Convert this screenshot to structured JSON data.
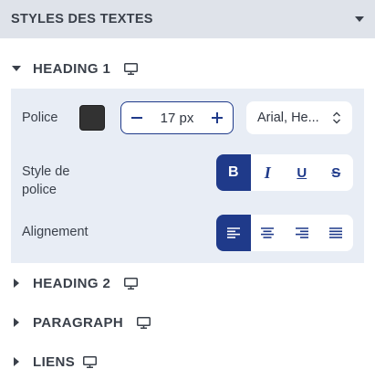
{
  "panel": {
    "title": "STYLES DES TEXTES",
    "collapse_icon": "caret-down-icon"
  },
  "sections": [
    {
      "label": "HEADING 1",
      "expanded": true,
      "device_icon": "desktop-icon"
    },
    {
      "label": "HEADING 2",
      "expanded": false,
      "device_icon": "desktop-icon"
    },
    {
      "label": "PARAGRAPH",
      "expanded": false,
      "device_icon": "desktop-icon"
    },
    {
      "label": "LIENS",
      "expanded": false,
      "device_icon": "desktop-icon"
    }
  ],
  "heading1": {
    "police_label": "Police",
    "color_swatch": "#323232",
    "size_value": "17 px",
    "font_value": "Arial, He...",
    "style_label": "Style de police",
    "style_buttons": [
      {
        "name": "bold",
        "glyph": "B",
        "active": true
      },
      {
        "name": "italic",
        "glyph": "I",
        "active": false
      },
      {
        "name": "underline",
        "glyph": "U",
        "active": false
      },
      {
        "name": "strikethrough",
        "glyph": "S",
        "active": false
      }
    ],
    "align_label": "Alignement",
    "align_buttons": [
      {
        "name": "align-left",
        "active": true
      },
      {
        "name": "align-center",
        "active": false
      },
      {
        "name": "align-right",
        "active": false
      },
      {
        "name": "align-justify",
        "active": false
      }
    ]
  },
  "colors": {
    "accent": "#1f3a8a",
    "header_bg": "#dfe3ea",
    "expanded_bg": "#e8edf5"
  }
}
